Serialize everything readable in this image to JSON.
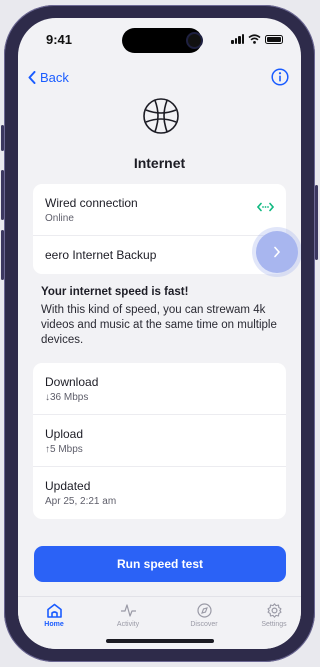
{
  "status": {
    "time": "9:41"
  },
  "nav": {
    "back_label": "Back"
  },
  "page": {
    "title": "Internet"
  },
  "connections": [
    {
      "label": "Wired connection",
      "sub": "Online"
    },
    {
      "label": "eero Internet Backup"
    }
  ],
  "speed_info": {
    "heading": "Your internet speed is fast!",
    "body": "With this kind of speed, you can strewam 4k videos and music at the same time on multiple devices."
  },
  "stats": [
    {
      "label": "Download",
      "value": "↓36 Mbps"
    },
    {
      "label": "Upload",
      "value": "↑5 Mbps"
    },
    {
      "label": "Updated",
      "value": "Apr 25, 2:21 am"
    }
  ],
  "actions": {
    "run_label": "Run speed test"
  },
  "tabs": [
    {
      "label": "Home",
      "icon": "home-icon"
    },
    {
      "label": "Activity",
      "icon": "activity-icon"
    },
    {
      "label": "Discover",
      "icon": "compass-icon"
    },
    {
      "label": "Settings",
      "icon": "gear-icon"
    }
  ],
  "colors": {
    "accent": "#2b62f6",
    "online": "#11b981",
    "frame": "#2e2b4a"
  }
}
